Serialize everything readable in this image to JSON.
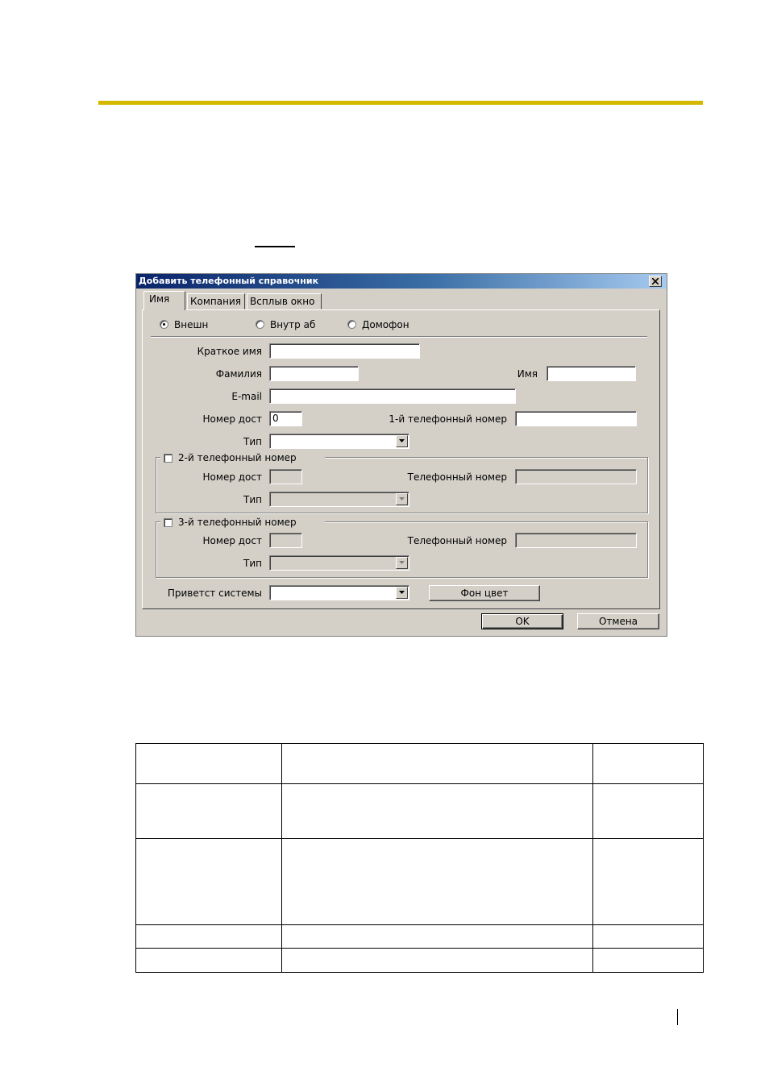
{
  "dialog": {
    "title": "Добавить телефонный справочник",
    "tabs": [
      {
        "label": "Имя",
        "active": true
      },
      {
        "label": "Компания",
        "active": false
      },
      {
        "label": "Всплыв окно",
        "active": false
      }
    ],
    "type_radios": [
      {
        "label": "Внешн",
        "selected": true
      },
      {
        "label": "Внутр аб",
        "selected": false
      },
      {
        "label": "Домофон",
        "selected": false
      }
    ],
    "form": {
      "short_name_label": "Краткое имя",
      "short_name_value": "",
      "last_name_label": "Фамилия",
      "last_name_value": "",
      "first_name_label": "Имя",
      "first_name_value": "",
      "email_label": "E-mail",
      "email_value": "",
      "access_num_label": "Номер дост",
      "access_num_value": "0",
      "phone1_label": "1-й телефонный номер",
      "phone1_value": "",
      "type_label": "Тип",
      "type_value": ""
    },
    "phone2_group": {
      "checkbox_label": "2-й телефонный номер",
      "checked": false,
      "access_num_label": "Номер дост",
      "phone_label": "Телефонный номер",
      "type_label": "Тип"
    },
    "phone3_group": {
      "checkbox_label": "3-й телефонный номер",
      "checked": false,
      "access_num_label": "Номер дост",
      "phone_label": "Телефонный номер",
      "type_label": "Тип"
    },
    "greeting_label": "Приветст системы",
    "greeting_value": "",
    "bg_color_button": "Фон цвет",
    "ok_button": "OK",
    "cancel_button": "Отмена"
  },
  "table": {
    "rows": [
      [
        "",
        "",
        ""
      ],
      [
        "",
        "",
        ""
      ],
      [
        "",
        "",
        ""
      ],
      [
        "",
        "",
        ""
      ],
      [
        "",
        "",
        ""
      ]
    ]
  }
}
